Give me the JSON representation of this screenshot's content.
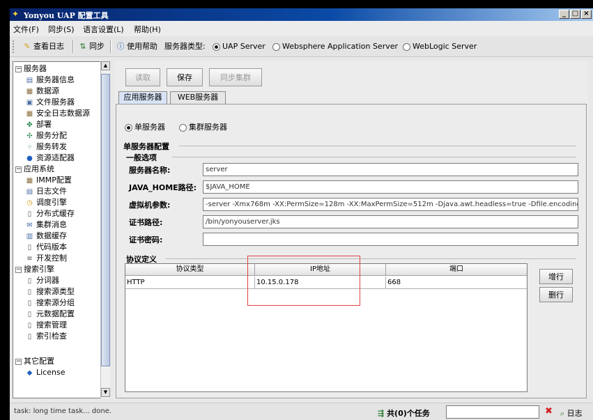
{
  "window": {
    "title": "Yonyou UAP 配置工具",
    "controls": [
      "_",
      "□",
      "×"
    ]
  },
  "menu": [
    "文件(F)",
    "同步(S)",
    "语言设置(L)",
    "帮助(H)"
  ],
  "toolbar": {
    "view_log": "查看日志",
    "sync": "同步",
    "help": "使用帮助",
    "server_type_label": "服务器类型:",
    "server_types": [
      {
        "label": "UAP Server",
        "selected": true
      },
      {
        "label": "Websphere Application Server",
        "selected": false
      },
      {
        "label": "WebLogic Server",
        "selected": false
      }
    ]
  },
  "tree": {
    "groups": [
      {
        "label": "服务器",
        "items": [
          {
            "label": "服务器信息",
            "icon": "server-icon"
          },
          {
            "label": "数据源",
            "icon": "datasource-icon"
          },
          {
            "label": "文件服务器",
            "icon": "file-server-icon"
          },
          {
            "label": "安全日志数据源",
            "icon": "datasource-icon"
          },
          {
            "label": "部署",
            "icon": "deploy-icon"
          },
          {
            "label": "服务分配",
            "icon": "service-assign-icon"
          },
          {
            "label": "服务转发",
            "icon": "service-forward-icon"
          },
          {
            "label": "资源适配器",
            "icon": "adapter-icon"
          }
        ]
      },
      {
        "label": "应用系统",
        "items": [
          {
            "label": "IMMP配置",
            "icon": "config-icon"
          },
          {
            "label": "日志文件",
            "icon": "log-file-icon"
          },
          {
            "label": "调度引擎",
            "icon": "scheduler-icon"
          },
          {
            "label": "分布式缓存",
            "icon": "doc-icon"
          },
          {
            "label": "集群消息",
            "icon": "mail-icon"
          },
          {
            "label": "数据缓存",
            "icon": "cache-icon"
          },
          {
            "label": "代码版本",
            "icon": "doc-icon"
          },
          {
            "label": "开发控制",
            "icon": "list-icon"
          }
        ]
      },
      {
        "label": "搜索引擎",
        "items": [
          {
            "label": "分词器",
            "icon": "doc-icon"
          },
          {
            "label": "搜索源类型",
            "icon": "doc-icon"
          },
          {
            "label": "搜索源分组",
            "icon": "doc-icon"
          },
          {
            "label": "元数据配置",
            "icon": "doc-icon"
          },
          {
            "label": "搜索管理",
            "icon": "doc-icon"
          },
          {
            "label": "索引检查",
            "icon": "doc-icon"
          }
        ]
      },
      {
        "label": "其它配置",
        "items": [
          {
            "label": "License",
            "icon": "license-icon"
          }
        ]
      }
    ]
  },
  "actions": {
    "read": "读取",
    "save": "保存",
    "sync_cluster": "同步集群"
  },
  "tabs": [
    "应用服务器",
    "WEB服务器"
  ],
  "server_mode": [
    {
      "label": "单服务器",
      "selected": true
    },
    {
      "label": "集群服务器",
      "selected": false
    }
  ],
  "single_server": {
    "section_title": "单服务器配置",
    "general_title": "一般选项",
    "fields": [
      {
        "label": "服务器名称:",
        "value": "server"
      },
      {
        "label": "JAVA_HOME路径:",
        "value": "$JAVA_HOME"
      },
      {
        "label": "虚拟机参数:",
        "value": "-server -Xmx768m -XX:PermSize=128m -XX:MaxPermSize=512m -Djava.awt.headless=true -Dfile.encoding"
      },
      {
        "label": "证书路径:",
        "value": "/bin/yonyouserver.jks"
      },
      {
        "label": "证书密码:",
        "value": ""
      }
    ]
  },
  "protocol": {
    "title": "协议定义",
    "columns": [
      "协议类型",
      "IP地址",
      "端口"
    ],
    "rows": [
      [
        "HTTP",
        "10.15.0.178",
        "668"
      ]
    ],
    "add_button": "增行",
    "delete_button": "删行"
  },
  "status": {
    "text": "task: long time task... done.",
    "tasks": "共(0)个任务",
    "log": "日志"
  }
}
